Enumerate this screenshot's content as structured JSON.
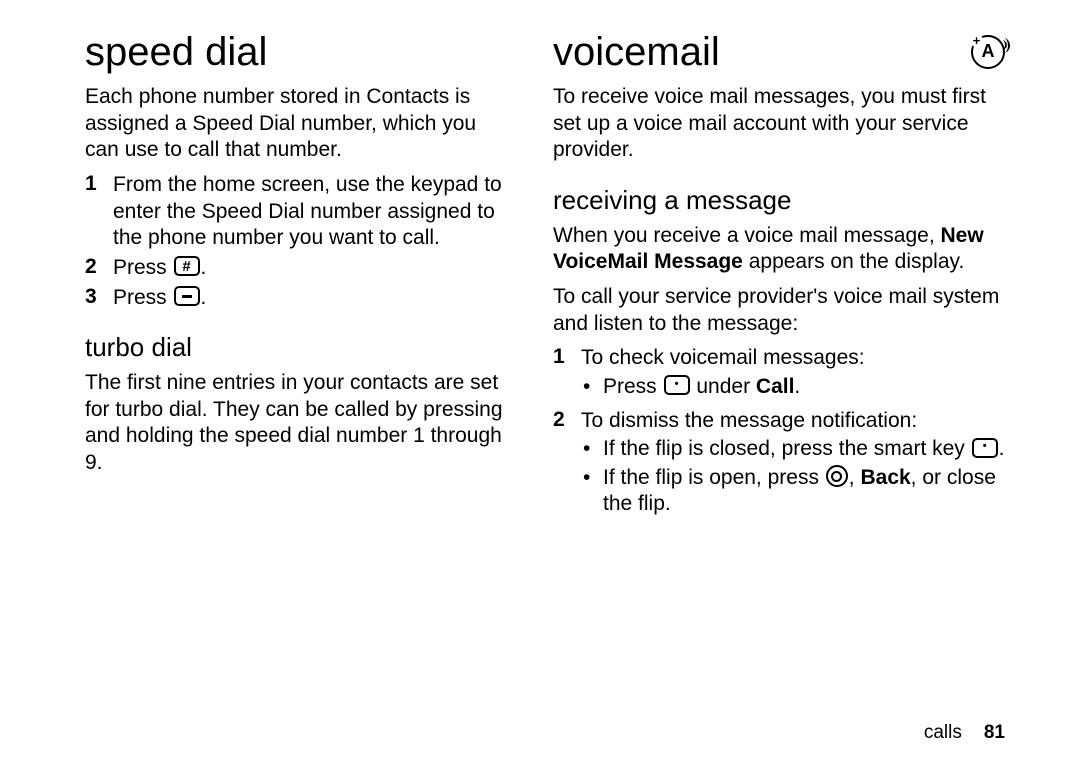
{
  "left": {
    "h1": "speed dial",
    "intro": "Each phone number stored in Contacts is assigned a Speed Dial number, which you can use to call that number.",
    "steps": {
      "s1": {
        "num": "1",
        "text": "From the home screen, use the keypad to enter the Speed Dial number assigned to the phone number you want to call."
      },
      "s2": {
        "num": "2",
        "prefix": "Press ",
        "suffix": "."
      },
      "s3": {
        "num": "3",
        "prefix": "Press ",
        "suffix": "."
      }
    },
    "h2": "turbo dial",
    "turbo_text": "The first nine entries in your contacts are set for turbo dial. They can be called by pressing and holding the speed dial number 1 through 9."
  },
  "right": {
    "h1": "voicemail",
    "intro": "To receive voice mail messages, you must first set up a voice mail account with your service provider.",
    "h2": "receiving a message",
    "rcv1_a": "When you receive a voice mail message, ",
    "rcv1_bold": "New VoiceMail Message",
    "rcv1_b": " appears on the display.",
    "rcv2": "To call your service provider's voice mail system and listen to the message:",
    "step1": {
      "num": "1",
      "text": "To check voicemail messages:",
      "b1_a": "Press ",
      "b1_b": " under ",
      "b1_bold": "Call",
      "b1_c": "."
    },
    "step2": {
      "num": "2",
      "text": "To dismiss the message notification:",
      "b1_a": "If the flip is closed, press the smart key ",
      "b1_b": ".",
      "b2_a": "If the flip is open, press ",
      "b2_b": ", ",
      "b2_bold": "Back",
      "b2_c": ", or close the flip."
    }
  },
  "footer": {
    "section": "calls",
    "page": "81"
  }
}
